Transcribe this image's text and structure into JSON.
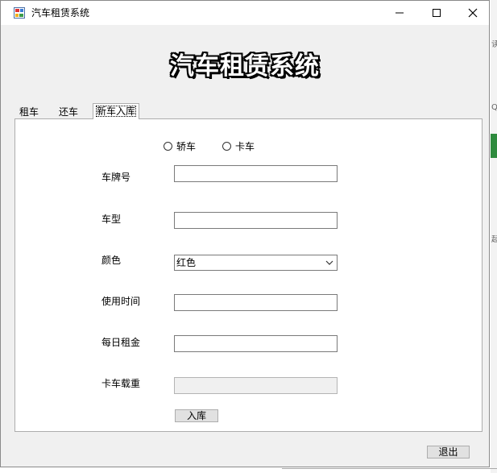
{
  "window": {
    "title": "汽车租赁系统",
    "app_icon": "app-icon",
    "controls": {
      "minimize": "minimize-icon",
      "maximize": "maximize-icon",
      "close": "close-icon"
    }
  },
  "header": {
    "title": "汽车租赁系统"
  },
  "tabs": [
    {
      "label": "租车"
    },
    {
      "label": "还车"
    },
    {
      "label": "新车入库",
      "selected": true
    }
  ],
  "form": {
    "vehicle_type": {
      "options": [
        {
          "label": "轿车",
          "checked": false
        },
        {
          "label": "卡车",
          "checked": false
        }
      ]
    },
    "plate": {
      "label": "车牌号",
      "value": ""
    },
    "model": {
      "label": "车型",
      "value": ""
    },
    "color": {
      "label": "颜色",
      "selected": "红色"
    },
    "usage_time": {
      "label": "使用时间",
      "value": ""
    },
    "daily_rent": {
      "label": "每日租金",
      "value": ""
    },
    "truck_load": {
      "label": "卡车载重",
      "value": "",
      "disabled": true
    },
    "submit_label": "入库"
  },
  "footer": {
    "exit_label": "退出"
  },
  "colors": {
    "window_bg": "#f0f0f0",
    "panel_bg": "#ffffff",
    "border": "#adadad"
  }
}
